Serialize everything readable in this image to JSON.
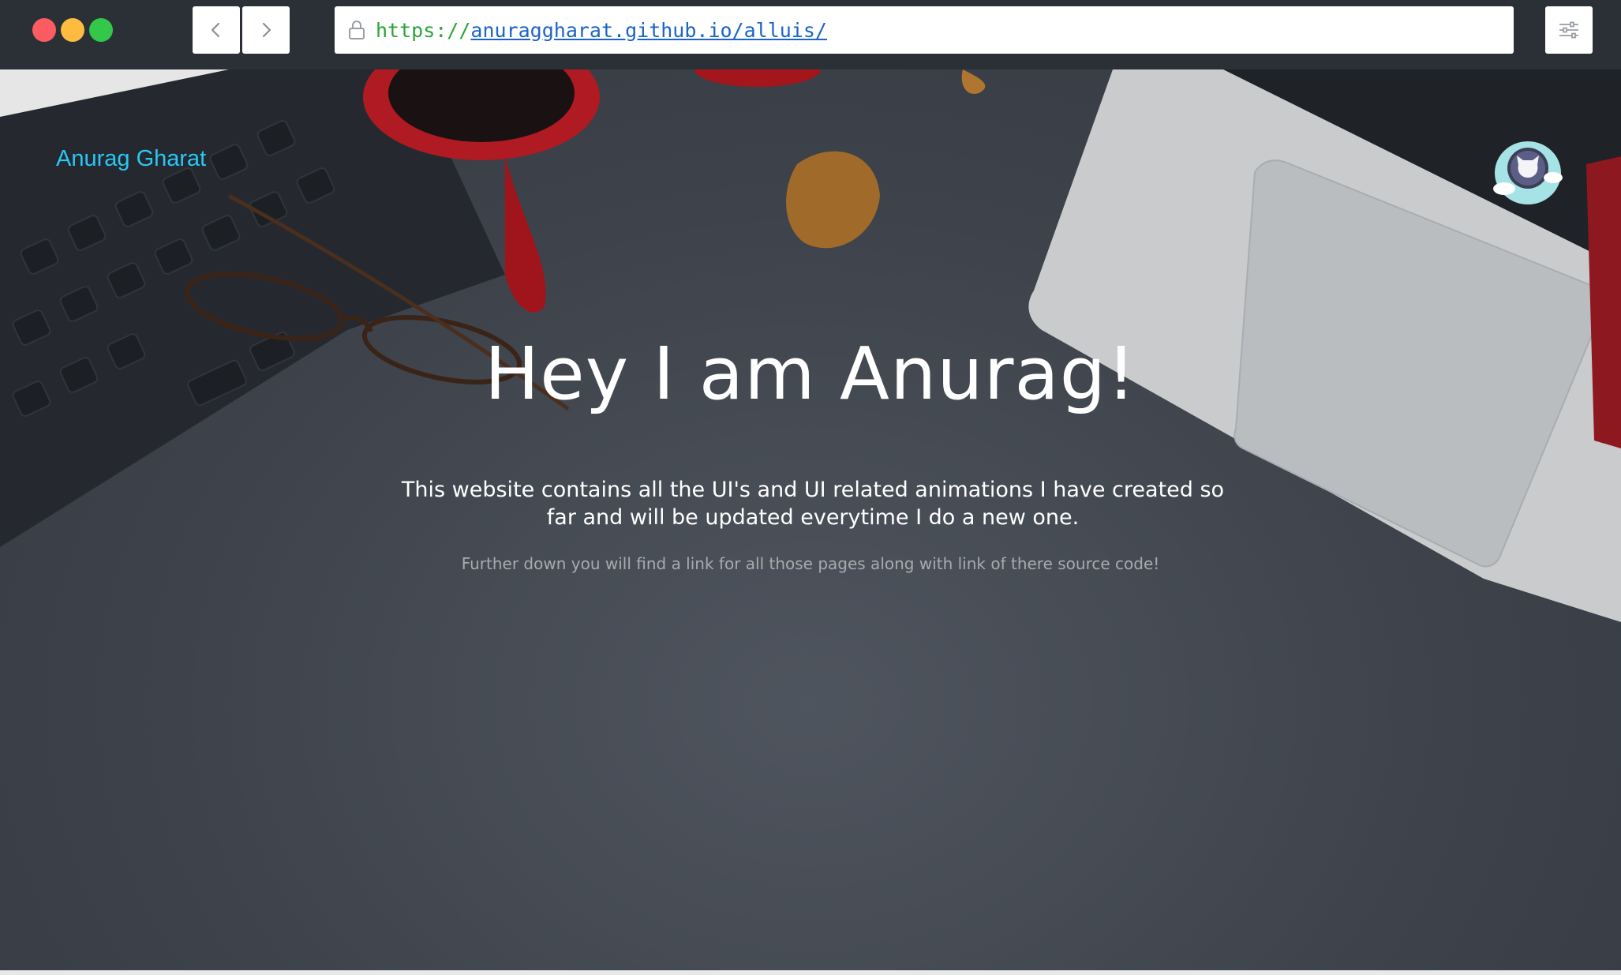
{
  "browser": {
    "url_scheme": "https://",
    "url_host_path": "anuraggharat.github.io/alluis/"
  },
  "page": {
    "brand": "Anurag Gharat",
    "title": "Hey I am Anurag!",
    "subtitle": "This website contains all the UI's and UI related animations I have created so far and will be updated everytime I do a new one.",
    "note": "Further down you will find a link for all those pages along with link of there source code!"
  },
  "icons": {
    "back": "chevron-left-icon",
    "forward": "chevron-right-icon",
    "lock": "lock-icon",
    "menu": "sliders-icon",
    "github": "github-octocat-icon"
  },
  "colors": {
    "brand": "#27c8f5",
    "url_scheme": "#2aa43a",
    "url_host": "#1a64c8",
    "topbar": "#2a3035"
  }
}
